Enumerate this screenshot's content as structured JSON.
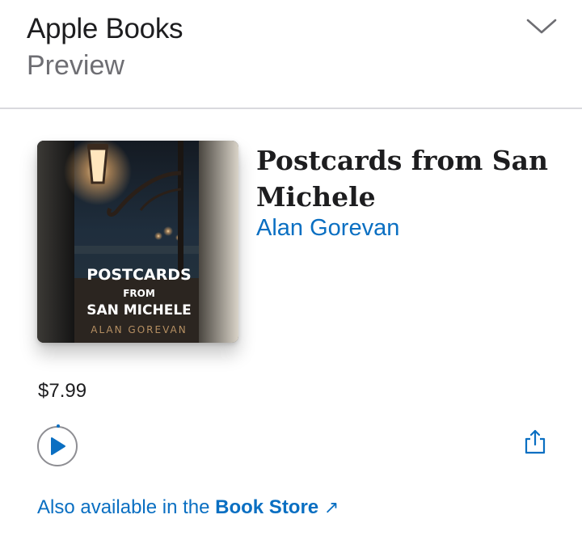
{
  "header": {
    "title": "Apple Books",
    "subtitle": "Preview",
    "collapse_icon": "chevron-down-icon"
  },
  "book": {
    "title": "Postcards from San Michele",
    "author": "Alan Gorevan",
    "price": "$7.99",
    "cover": {
      "line1": "POSTCARDS",
      "line2": "FROM",
      "line3": "SAN MICHELE",
      "author": "ALAN GOREVAN"
    }
  },
  "actions": {
    "play_icon": "play-icon",
    "share_icon": "share-icon"
  },
  "footer": {
    "prefix": "Also available in the ",
    "link": "Book Store",
    "link_icon": "external-arrow-icon"
  },
  "colors": {
    "accent": "#0a6fc2",
    "title": "#1d1d1f",
    "secondary": "#6e6e73",
    "divider": "#d9d9de"
  }
}
